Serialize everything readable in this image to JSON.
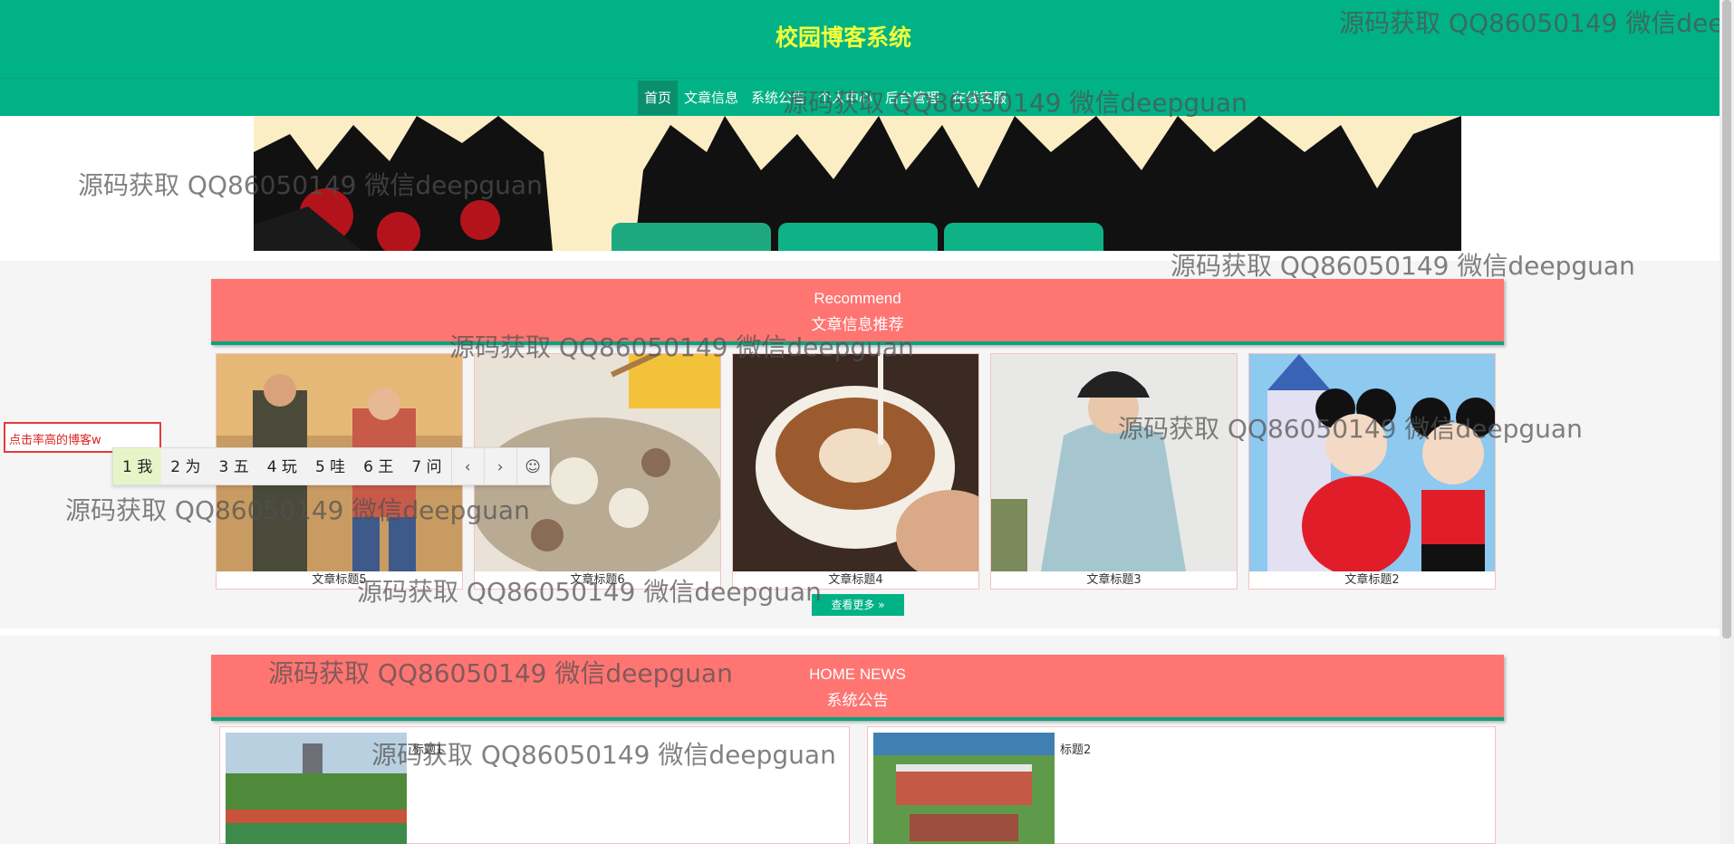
{
  "site": {
    "title": "校园博客系统"
  },
  "nav": {
    "items": [
      {
        "label": "首页",
        "active": true
      },
      {
        "label": "文章信息",
        "active": false
      },
      {
        "label": "系统公告",
        "active": false
      },
      {
        "label": "个人中心",
        "active": false
      },
      {
        "label": "后台管理",
        "active": false
      },
      {
        "label": "在线客服",
        "active": false
      }
    ]
  },
  "recommend": {
    "title_en": "Recommend",
    "title_cn": "文章信息推荐",
    "cards": [
      {
        "title": "文章标题5",
        "image": "movie-poster"
      },
      {
        "title": "文章标题6",
        "image": "lotus-soup"
      },
      {
        "title": "文章标题4",
        "image": "latte-coffee"
      },
      {
        "title": "文章标题3",
        "image": "hoodie-model"
      },
      {
        "title": "文章标题2",
        "image": "disney-mickey-minnie"
      }
    ],
    "more_label": "查看更多",
    "more_icon": "double-chevron-right-icon"
  },
  "news": {
    "title_en": "HOME NEWS",
    "title_cn": "系统公告",
    "items": [
      {
        "title": "标题1",
        "image": "campus-field"
      },
      {
        "title": "标题2",
        "image": "campus-building"
      }
    ]
  },
  "search": {
    "value": "点击率高的博客w"
  },
  "ime": {
    "candidates": [
      "1 我",
      "2 为",
      "3 五",
      "4 玩",
      "5 哇",
      "6 王",
      "7 问"
    ],
    "prev_icon": "chevron-left-icon",
    "next_icon": "chevron-right-icon",
    "emoji_icon": "smiley-icon"
  },
  "watermarks": {
    "text": "源码获取 QQ86050149 微信deepguan",
    "clipped": "源码获取 QQ86050149 微信dee"
  },
  "colors": {
    "primary": "#01b286",
    "title_yellow": "#f2ff3a",
    "accent_red": "#fe7572",
    "search_border": "#e23b3b"
  }
}
